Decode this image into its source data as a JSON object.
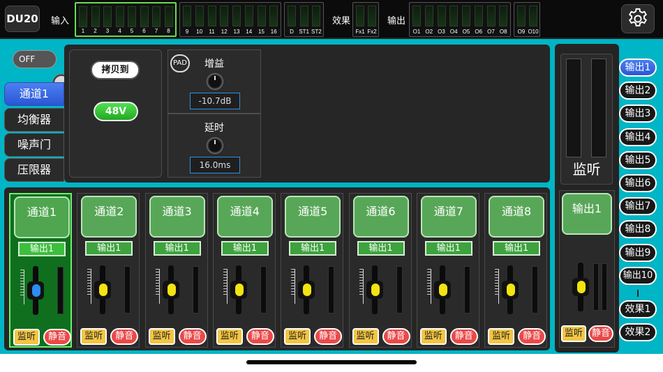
{
  "app": {
    "logo": "DU20"
  },
  "topbar": {
    "input_label": "输入",
    "fx_label": "效果",
    "output_label": "输出",
    "input_groups": [
      [
        "1",
        "2",
        "3",
        "4",
        "5",
        "6",
        "7",
        "8"
      ],
      [
        "9",
        "10",
        "11",
        "12",
        "13",
        "14",
        "15",
        "16"
      ],
      [
        "D",
        "ST1",
        "ST2"
      ]
    ],
    "fx_meters": [
      "Fx1",
      "Fx2"
    ],
    "output_groups": [
      [
        "O1",
        "O2",
        "O3",
        "O4",
        "O5",
        "O6",
        "O7",
        "O8"
      ],
      [
        "O9",
        "O10"
      ]
    ],
    "settings_icon": "gear-icon"
  },
  "power_toggle": {
    "label": "OFF",
    "state": "off"
  },
  "side_tabs": [
    "通道1",
    "均衡器",
    "噪声门",
    "压限器"
  ],
  "active_tab_index": 0,
  "channel_panel": {
    "copy_to": "拷贝到",
    "phantom": "48V",
    "pad": "PAD",
    "gain": {
      "title": "增益",
      "value": "-10.7dB"
    },
    "delay": {
      "title": "延时",
      "value": "16.0ms"
    }
  },
  "strips": [
    {
      "name": "通道1",
      "output": "输出1",
      "solo": "监听",
      "mute": "静音",
      "selected": true
    },
    {
      "name": "通道2",
      "output": "输出1",
      "solo": "监听",
      "mute": "静音",
      "selected": false
    },
    {
      "name": "通道3",
      "output": "输出1",
      "solo": "监听",
      "mute": "静音",
      "selected": false
    },
    {
      "name": "通道4",
      "output": "输出1",
      "solo": "监听",
      "mute": "静音",
      "selected": false
    },
    {
      "name": "通道5",
      "output": "输出1",
      "solo": "监听",
      "mute": "静音",
      "selected": false
    },
    {
      "name": "通道6",
      "output": "输出1",
      "solo": "监听",
      "mute": "静音",
      "selected": false
    },
    {
      "name": "通道7",
      "output": "输出1",
      "solo": "监听",
      "mute": "静音",
      "selected": false
    },
    {
      "name": "通道8",
      "output": "输出1",
      "solo": "监听",
      "mute": "静音",
      "selected": false
    }
  ],
  "monitor": {
    "title": "监听"
  },
  "output_strip": {
    "name": "输出1",
    "solo": "监听",
    "mute": "静音"
  },
  "output_buttons": [
    "输出1",
    "输出2",
    "输出3",
    "输出4",
    "输出5",
    "输出6",
    "输出7",
    "输出8",
    "输出9",
    "输出10"
  ],
  "active_output_index": 0,
  "fx_buttons": [
    "效果1",
    "效果2"
  ],
  "colors": {
    "accent_blue": "#2a56d4",
    "strip_green": "#58a758",
    "background_cyan": "#00b5c5",
    "solo_yellow": "#f3c542",
    "mute_red": "#ea4949"
  }
}
